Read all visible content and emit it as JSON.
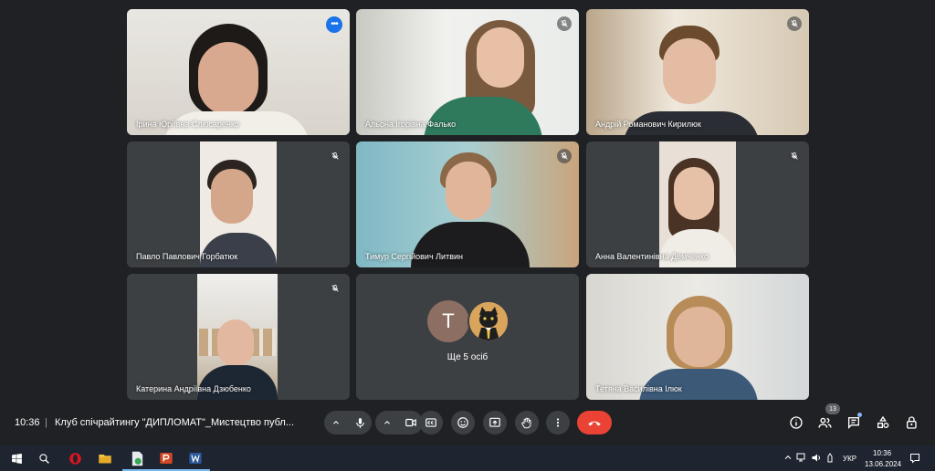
{
  "participants": [
    {
      "name": "Ірина Юріївна Слюсаренко"
    },
    {
      "name": "Альона Ігорівна Фалько"
    },
    {
      "name": "Андрій Романович Кирилюк"
    },
    {
      "name": "Павло Павлович Горбатюк"
    },
    {
      "name": "Тимур Сергійович Литвин"
    },
    {
      "name": "Анна Валентинівна Демченко"
    },
    {
      "name": "Катерина Андріївна Дзюбенко"
    },
    {
      "name": "Тетяна Василівна Ілюк"
    }
  ],
  "others": {
    "avatar_letter": "T",
    "label": "Ще 5 осіб"
  },
  "meeting": {
    "time": "10:36",
    "separator": "|",
    "title": "Клуб спічрайтингу \"ДИПЛОМАТ\"_Мистецтво публ..."
  },
  "people_count": "13",
  "taskbar": {
    "language": "УКР",
    "time": "10:36",
    "date": "13.06.2024"
  },
  "colors": {
    "background": "#202124",
    "tile": "#3c4043",
    "end_call": "#ea4335",
    "speaking_outline": "#8ab4f8"
  }
}
